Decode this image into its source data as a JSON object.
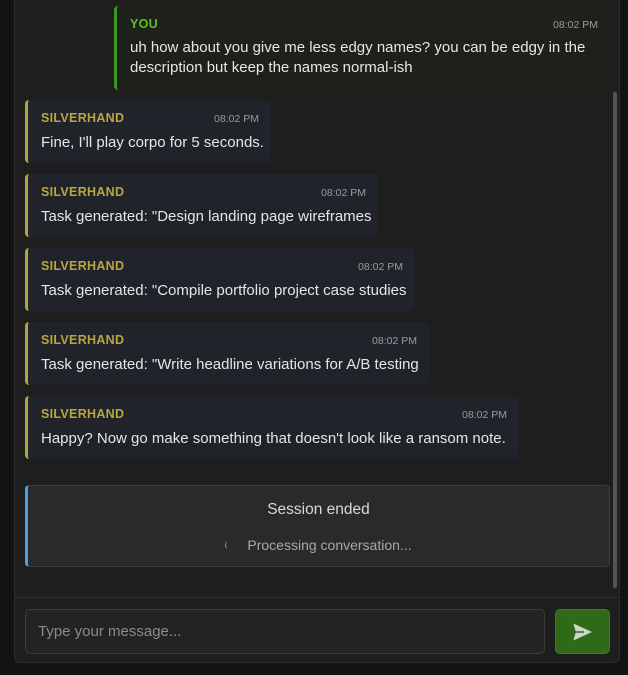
{
  "messages": [
    {
      "sender": "YOU",
      "time": "08:02 PM",
      "text": "uh how about you give me less edgy names? you can be edgy in the description but keep the names normal-ish"
    },
    {
      "sender": "SILVERHAND",
      "time": "08:02 PM",
      "text": "Fine, I'll play corpo for 5 seconds."
    },
    {
      "sender": "SILVERHAND",
      "time": "08:02 PM",
      "text": "Task generated: \"Design landing page wireframes"
    },
    {
      "sender": "SILVERHAND",
      "time": "08:02 PM",
      "text": "Task generated: \"Compile portfolio project case studies"
    },
    {
      "sender": "SILVERHAND",
      "time": "08:02 PM",
      "text": "Task generated: \"Write headline variations for A/B testing"
    },
    {
      "sender": "SILVERHAND",
      "time": "08:02 PM",
      "text": "Happy? Now go make something that doesn't look like a ransom note."
    }
  ],
  "session": {
    "title": "Session ended",
    "status": "Processing conversation..."
  },
  "composer": {
    "placeholder": "Type your message...",
    "send_icon": "send-icon"
  },
  "colors": {
    "user_accent": "#3a9a1e",
    "bot_accent": "#b5a43c",
    "info_accent": "#4aa3df",
    "send_button": "#2e6a17"
  }
}
